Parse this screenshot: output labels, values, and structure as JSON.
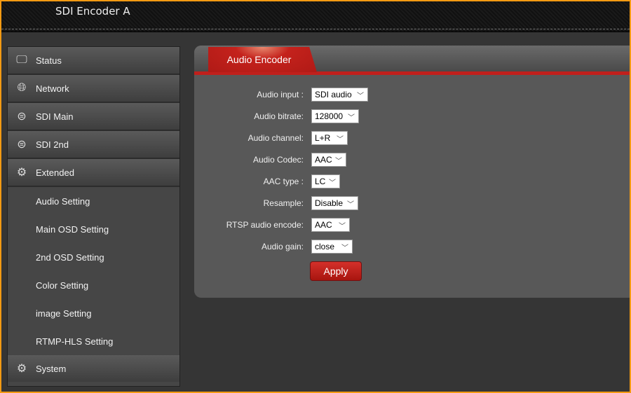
{
  "header": {
    "title": "SDI Encoder  A"
  },
  "sidebar": {
    "items": [
      {
        "label": "Status",
        "icon": "monitor-icon"
      },
      {
        "label": "Network",
        "icon": "globe-icon"
      },
      {
        "label": "SDI Main",
        "icon": "disk-drive-icon"
      },
      {
        "label": "SDI 2nd",
        "icon": "disk-drive-icon"
      },
      {
        "label": "Extended",
        "icon": "dotted-gear-icon"
      }
    ],
    "subitems": [
      "Audio Setting",
      "Main OSD Setting",
      "2nd OSD Setting",
      "Color Setting",
      "image Setting",
      "RTMP-HLS Setting"
    ],
    "system": {
      "label": "System",
      "icon": "gear-icon"
    }
  },
  "panel": {
    "tab": "Audio Encoder",
    "fields": [
      {
        "label": "Audio input :",
        "value": "SDI audio"
      },
      {
        "label": "Audio bitrate:",
        "value": "128000"
      },
      {
        "label": "Audio channel:",
        "value": "L+R"
      },
      {
        "label": "Audio Codec:",
        "value": "AAC"
      },
      {
        "label": "AAC type :",
        "value": "LC"
      },
      {
        "label": "Resample:",
        "value": "Disable"
      },
      {
        "label": "RTSP audio encode:",
        "value": "AAC"
      },
      {
        "label": "Audio gain:",
        "value": "close"
      }
    ],
    "apply": "Apply"
  },
  "colors": {
    "accent": "#c0201c",
    "border": "#f39a12"
  }
}
